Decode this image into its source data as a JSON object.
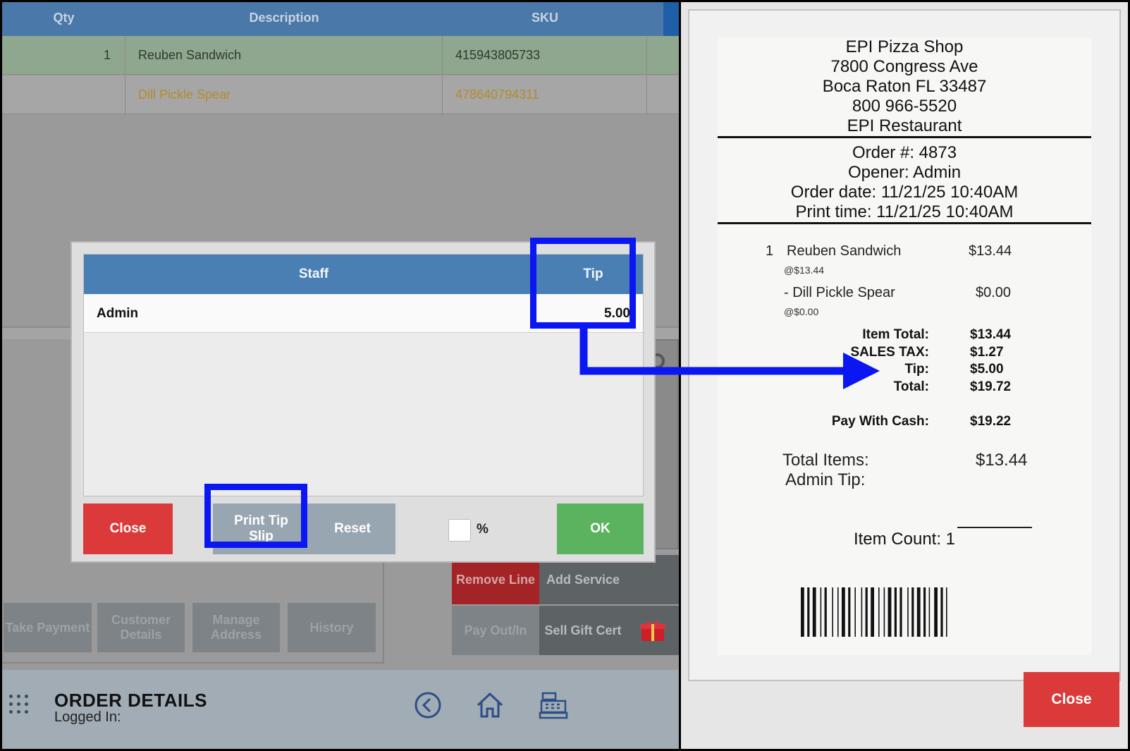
{
  "grid": {
    "headers": {
      "qty": "Qty",
      "description": "Description",
      "sku": "SKU"
    },
    "rows": [
      {
        "qty": "1",
        "description": "Reuben Sandwich",
        "sku": "415943805733"
      },
      {
        "qty": "",
        "description": "Dill Pickle Spear",
        "sku": "478640794311"
      }
    ]
  },
  "dialog": {
    "headers": {
      "staff": "Staff",
      "tip": "Tip"
    },
    "rows": [
      {
        "staff": "Admin",
        "tip": "5.00"
      }
    ],
    "buttons": {
      "close": "Close",
      "print_tip_slip": "Print Tip Slip",
      "reset": "Reset",
      "ok": "OK"
    },
    "percent_label": "%"
  },
  "function_buttons": {
    "take_payment": "Take Payment",
    "customer_details": "Customer Details",
    "manage_address": "Manage Address",
    "history": "History",
    "remove_line": "Remove Line",
    "add_service": "Add Service",
    "pay_out_in": "Pay Out/In",
    "sell_gift_cert": "Sell Gift Cert"
  },
  "bottom_bar": {
    "title": "ORDER DETAILS",
    "logged_in_label": "Logged In:"
  },
  "receipt": {
    "header_lines": [
      "EPI Pizza Shop",
      "7800 Congress Ave",
      "Boca Raton FL 33487",
      "800 966-5520",
      "EPI Restaurant"
    ],
    "order_lines": [
      "Order #: 4873",
      "Opener: Admin",
      "Order date: 11/21/25 10:40AM",
      "Print time: 11/21/25 10:40AM"
    ],
    "items": [
      {
        "qty": "1",
        "name": "Reuben Sandwich",
        "price": "$13.44",
        "unit": "@$13.44"
      },
      {
        "qty": "",
        "name": "- Dill Pickle Spear",
        "price": "$0.00",
        "unit": "@$0.00"
      }
    ],
    "totals": [
      {
        "label": "Item Total:",
        "value": "$13.44"
      },
      {
        "label": "SALES TAX:",
        "value": "$1.27"
      },
      {
        "label": "Tip:",
        "value": "$5.00"
      },
      {
        "label": "Total:",
        "value": "$19.72"
      }
    ],
    "payment": {
      "label": "Pay With Cash:",
      "value": "$19.22"
    },
    "summary": {
      "total_items_label": "Total Items:",
      "total_items_value": "$13.44",
      "admin_tip_label": "Admin  Tip:"
    },
    "item_count": "Item Count: 1"
  },
  "right_close": "Close",
  "colors": {
    "highlight": "#0a17f2",
    "close_red": "#dc3a3a",
    "ok_green": "#5cb35f",
    "header_blue": "#4a7fb4"
  }
}
